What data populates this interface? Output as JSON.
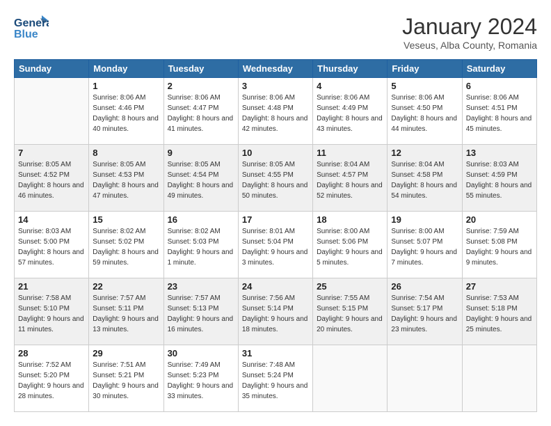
{
  "logo": {
    "part1": "General",
    "part2": "Blue"
  },
  "title": "January 2024",
  "subtitle": "Veseus, Alba County, Romania",
  "days_header": [
    "Sunday",
    "Monday",
    "Tuesday",
    "Wednesday",
    "Thursday",
    "Friday",
    "Saturday"
  ],
  "weeks": [
    [
      {
        "num": "",
        "sunrise": "",
        "sunset": "",
        "daylight": ""
      },
      {
        "num": "1",
        "sunrise": "Sunrise: 8:06 AM",
        "sunset": "Sunset: 4:46 PM",
        "daylight": "Daylight: 8 hours and 40 minutes."
      },
      {
        "num": "2",
        "sunrise": "Sunrise: 8:06 AM",
        "sunset": "Sunset: 4:47 PM",
        "daylight": "Daylight: 8 hours and 41 minutes."
      },
      {
        "num": "3",
        "sunrise": "Sunrise: 8:06 AM",
        "sunset": "Sunset: 4:48 PM",
        "daylight": "Daylight: 8 hours and 42 minutes."
      },
      {
        "num": "4",
        "sunrise": "Sunrise: 8:06 AM",
        "sunset": "Sunset: 4:49 PM",
        "daylight": "Daylight: 8 hours and 43 minutes."
      },
      {
        "num": "5",
        "sunrise": "Sunrise: 8:06 AM",
        "sunset": "Sunset: 4:50 PM",
        "daylight": "Daylight: 8 hours and 44 minutes."
      },
      {
        "num": "6",
        "sunrise": "Sunrise: 8:06 AM",
        "sunset": "Sunset: 4:51 PM",
        "daylight": "Daylight: 8 hours and 45 minutes."
      }
    ],
    [
      {
        "num": "7",
        "sunrise": "Sunrise: 8:05 AM",
        "sunset": "Sunset: 4:52 PM",
        "daylight": "Daylight: 8 hours and 46 minutes."
      },
      {
        "num": "8",
        "sunrise": "Sunrise: 8:05 AM",
        "sunset": "Sunset: 4:53 PM",
        "daylight": "Daylight: 8 hours and 47 minutes."
      },
      {
        "num": "9",
        "sunrise": "Sunrise: 8:05 AM",
        "sunset": "Sunset: 4:54 PM",
        "daylight": "Daylight: 8 hours and 49 minutes."
      },
      {
        "num": "10",
        "sunrise": "Sunrise: 8:05 AM",
        "sunset": "Sunset: 4:55 PM",
        "daylight": "Daylight: 8 hours and 50 minutes."
      },
      {
        "num": "11",
        "sunrise": "Sunrise: 8:04 AM",
        "sunset": "Sunset: 4:57 PM",
        "daylight": "Daylight: 8 hours and 52 minutes."
      },
      {
        "num": "12",
        "sunrise": "Sunrise: 8:04 AM",
        "sunset": "Sunset: 4:58 PM",
        "daylight": "Daylight: 8 hours and 54 minutes."
      },
      {
        "num": "13",
        "sunrise": "Sunrise: 8:03 AM",
        "sunset": "Sunset: 4:59 PM",
        "daylight": "Daylight: 8 hours and 55 minutes."
      }
    ],
    [
      {
        "num": "14",
        "sunrise": "Sunrise: 8:03 AM",
        "sunset": "Sunset: 5:00 PM",
        "daylight": "Daylight: 8 hours and 57 minutes."
      },
      {
        "num": "15",
        "sunrise": "Sunrise: 8:02 AM",
        "sunset": "Sunset: 5:02 PM",
        "daylight": "Daylight: 8 hours and 59 minutes."
      },
      {
        "num": "16",
        "sunrise": "Sunrise: 8:02 AM",
        "sunset": "Sunset: 5:03 PM",
        "daylight": "Daylight: 9 hours and 1 minute."
      },
      {
        "num": "17",
        "sunrise": "Sunrise: 8:01 AM",
        "sunset": "Sunset: 5:04 PM",
        "daylight": "Daylight: 9 hours and 3 minutes."
      },
      {
        "num": "18",
        "sunrise": "Sunrise: 8:00 AM",
        "sunset": "Sunset: 5:06 PM",
        "daylight": "Daylight: 9 hours and 5 minutes."
      },
      {
        "num": "19",
        "sunrise": "Sunrise: 8:00 AM",
        "sunset": "Sunset: 5:07 PM",
        "daylight": "Daylight: 9 hours and 7 minutes."
      },
      {
        "num": "20",
        "sunrise": "Sunrise: 7:59 AM",
        "sunset": "Sunset: 5:08 PM",
        "daylight": "Daylight: 9 hours and 9 minutes."
      }
    ],
    [
      {
        "num": "21",
        "sunrise": "Sunrise: 7:58 AM",
        "sunset": "Sunset: 5:10 PM",
        "daylight": "Daylight: 9 hours and 11 minutes."
      },
      {
        "num": "22",
        "sunrise": "Sunrise: 7:57 AM",
        "sunset": "Sunset: 5:11 PM",
        "daylight": "Daylight: 9 hours and 13 minutes."
      },
      {
        "num": "23",
        "sunrise": "Sunrise: 7:57 AM",
        "sunset": "Sunset: 5:13 PM",
        "daylight": "Daylight: 9 hours and 16 minutes."
      },
      {
        "num": "24",
        "sunrise": "Sunrise: 7:56 AM",
        "sunset": "Sunset: 5:14 PM",
        "daylight": "Daylight: 9 hours and 18 minutes."
      },
      {
        "num": "25",
        "sunrise": "Sunrise: 7:55 AM",
        "sunset": "Sunset: 5:15 PM",
        "daylight": "Daylight: 9 hours and 20 minutes."
      },
      {
        "num": "26",
        "sunrise": "Sunrise: 7:54 AM",
        "sunset": "Sunset: 5:17 PM",
        "daylight": "Daylight: 9 hours and 23 minutes."
      },
      {
        "num": "27",
        "sunrise": "Sunrise: 7:53 AM",
        "sunset": "Sunset: 5:18 PM",
        "daylight": "Daylight: 9 hours and 25 minutes."
      }
    ],
    [
      {
        "num": "28",
        "sunrise": "Sunrise: 7:52 AM",
        "sunset": "Sunset: 5:20 PM",
        "daylight": "Daylight: 9 hours and 28 minutes."
      },
      {
        "num": "29",
        "sunrise": "Sunrise: 7:51 AM",
        "sunset": "Sunset: 5:21 PM",
        "daylight": "Daylight: 9 hours and 30 minutes."
      },
      {
        "num": "30",
        "sunrise": "Sunrise: 7:49 AM",
        "sunset": "Sunset: 5:23 PM",
        "daylight": "Daylight: 9 hours and 33 minutes."
      },
      {
        "num": "31",
        "sunrise": "Sunrise: 7:48 AM",
        "sunset": "Sunset: 5:24 PM",
        "daylight": "Daylight: 9 hours and 35 minutes."
      },
      {
        "num": "",
        "sunrise": "",
        "sunset": "",
        "daylight": ""
      },
      {
        "num": "",
        "sunrise": "",
        "sunset": "",
        "daylight": ""
      },
      {
        "num": "",
        "sunrise": "",
        "sunset": "",
        "daylight": ""
      }
    ]
  ]
}
